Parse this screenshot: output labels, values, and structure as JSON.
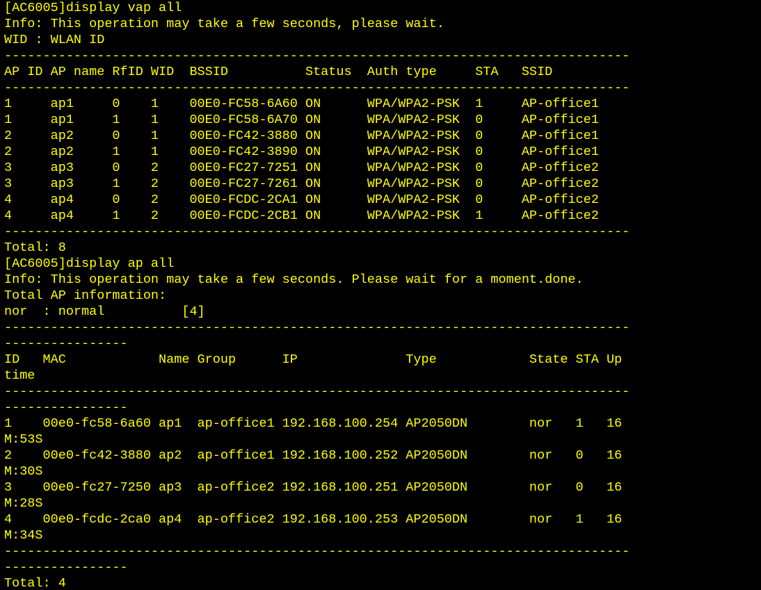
{
  "terminal": {
    "text_color": "#ffff00",
    "background_color": "#000000",
    "lines": [
      "[AC6005]display vap all",
      "Info: This operation may take a few seconds, please wait.",
      "WID : WLAN ID",
      "---------------------------------------------------------------------------------",
      "AP ID AP name RfID WID  BSSID          Status  Auth type     STA   SSID",
      "---------------------------------------------------------------------------------",
      "1     ap1     0    1    00E0-FC58-6A60 ON      WPA/WPA2-PSK  1     AP-office1",
      "1     ap1     1    1    00E0-FC58-6A70 ON      WPA/WPA2-PSK  0     AP-office1",
      "2     ap2     0    1    00E0-FC42-3880 ON      WPA/WPA2-PSK  0     AP-office1",
      "2     ap2     1    1    00E0-FC42-3890 ON      WPA/WPA2-PSK  0     AP-office1",
      "3     ap3     0    2    00E0-FC27-7251 ON      WPA/WPA2-PSK  0     AP-office2",
      "3     ap3     1    2    00E0-FC27-7261 ON      WPA/WPA2-PSK  0     AP-office2",
      "4     ap4     0    2    00E0-FCDC-2CA1 ON      WPA/WPA2-PSK  0     AP-office2",
      "4     ap4     1    2    00E0-FCDC-2CB1 ON      WPA/WPA2-PSK  1     AP-office2",
      "---------------------------------------------------------------------------------",
      "Total: 8",
      "[AC6005]display ap all",
      "Info: This operation may take a few seconds. Please wait for a moment.done.",
      "Total AP information:",
      "nor  : normal          [4]",
      "---------------------------------------------------------------------------------",
      "----------------",
      "ID   MAC            Name Group      IP              Type            State STA Up",
      "time",
      "---------------------------------------------------------------------------------",
      "----------------",
      "1    00e0-fc58-6a60 ap1  ap-office1 192.168.100.254 AP2050DN        nor   1   16",
      "M:53S",
      "2    00e0-fc42-3880 ap2  ap-office1 192.168.100.252 AP2050DN        nor   0   16",
      "M:30S",
      "3    00e0-fc27-7250 ap3  ap-office2 192.168.100.251 AP2050DN        nor   0   16",
      "M:28S",
      "4    00e0-fcdc-2ca0 ap4  ap-office2 192.168.100.253 AP2050DN        nor   1   16",
      "M:34S",
      "---------------------------------------------------------------------------------",
      "----------------",
      "Total: 4"
    ]
  }
}
